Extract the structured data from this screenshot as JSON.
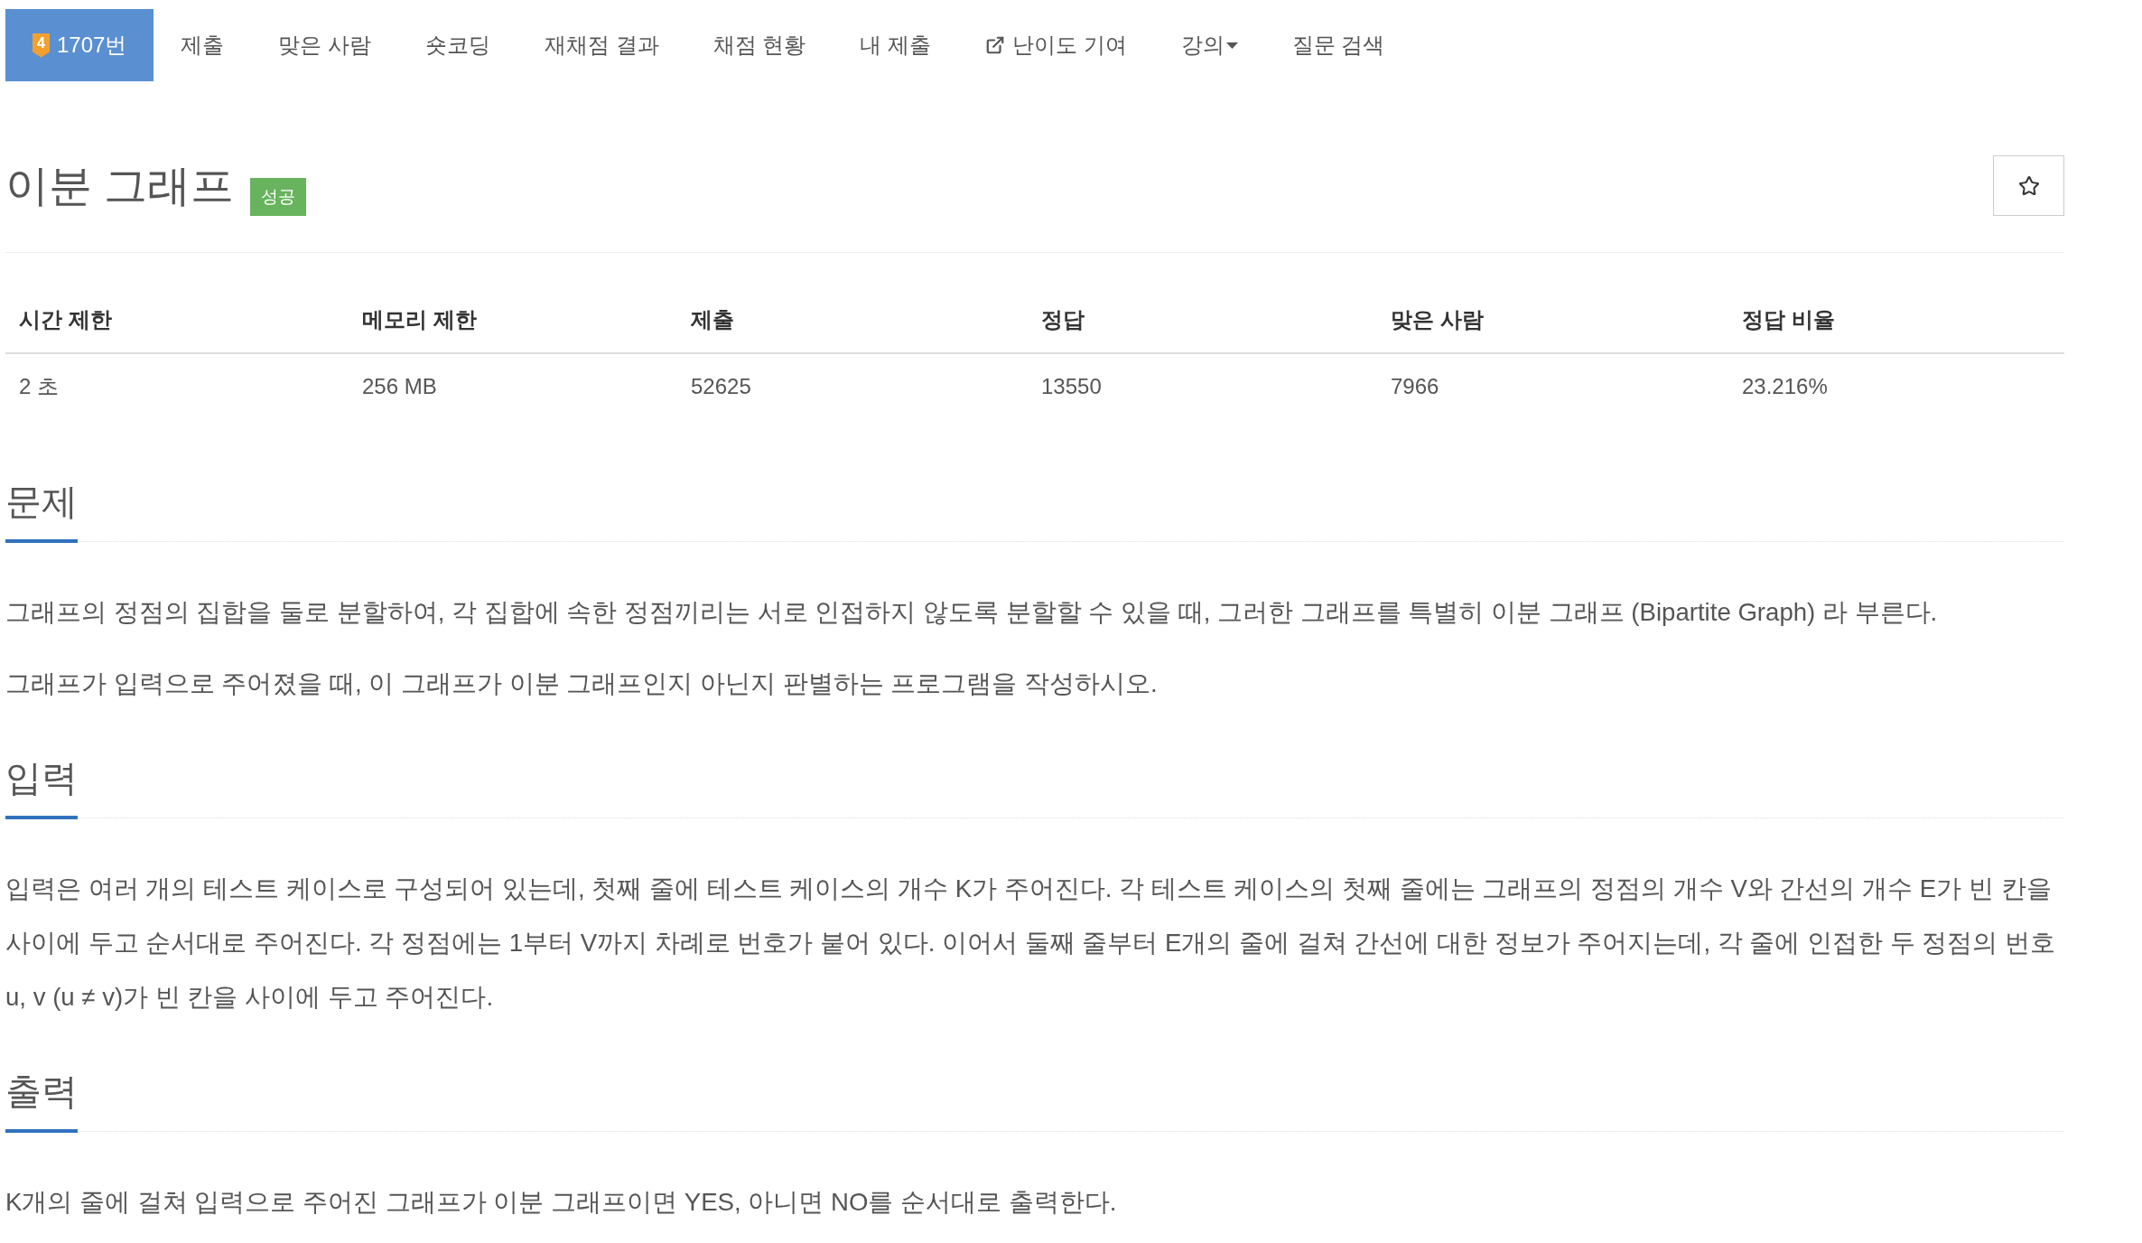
{
  "nav": {
    "tabs": [
      {
        "kind": "problem",
        "tier": "4",
        "label": "1707번",
        "selected": true
      },
      {
        "kind": "link",
        "label": "제출",
        "selected": false
      },
      {
        "kind": "link",
        "label": "맞은 사람",
        "selected": false
      },
      {
        "kind": "link",
        "label": "숏코딩",
        "selected": false
      },
      {
        "kind": "link",
        "label": "재채점 결과",
        "selected": false
      },
      {
        "kind": "link",
        "label": "채점 현황",
        "selected": false
      },
      {
        "kind": "link",
        "label": "내 제출",
        "selected": false
      },
      {
        "kind": "external",
        "label": "난이도 기여",
        "selected": false
      },
      {
        "kind": "dropdown",
        "label": "강의",
        "selected": false
      },
      {
        "kind": "link",
        "label": "질문 검색",
        "selected": false
      }
    ]
  },
  "problem": {
    "title": "이분 그래프",
    "result_badge": "성공"
  },
  "info_table": {
    "columns": [
      "시간 제한",
      "메모리 제한",
      "제출",
      "정답",
      "맞은 사람",
      "정답 비율"
    ],
    "rows": [
      [
        "2 초",
        "256 MB",
        "52625",
        "13550",
        "7966",
        "23.216%"
      ]
    ]
  },
  "sections": [
    {
      "heading": "문제",
      "paragraphs": [
        "그래프의 정점의 집합을 둘로 분할하여, 각 집합에 속한 정점끼리는 서로 인접하지 않도록 분할할 수 있을 때, 그러한 그래프를 특별히 이분 그래프 (Bipartite Graph) 라 부른다.",
        "그래프가 입력으로 주어졌을 때, 이 그래프가 이분 그래프인지 아닌지 판별하는 프로그램을 작성하시오."
      ]
    },
    {
      "heading": "입력",
      "paragraphs": [
        "입력은 여러 개의 테스트 케이스로 구성되어 있는데, 첫째 줄에 테스트 케이스의 개수 K가 주어진다. 각 테스트 케이스의 첫째 줄에는 그래프의 정점의 개수 V와 간선의 개수 E가 빈 칸을 사이에 두고 순서대로 주어진다. 각 정점에는 1부터 V까지 차례로 번호가 붙어 있다. 이어서 둘째 줄부터 E개의 줄에 걸쳐 간선에 대한 정보가 주어지는데, 각 줄에 인접한 두 정점의 번호 u, v (u ≠ v)가 빈 칸을 사이에 두고 주어진다."
      ]
    },
    {
      "heading": "출력",
      "paragraphs": [
        "K개의 줄에 걸쳐 입력으로 주어진 그래프가 이분 그래프이면 YES, 아니면 NO를 순서대로 출력한다."
      ]
    }
  ]
}
